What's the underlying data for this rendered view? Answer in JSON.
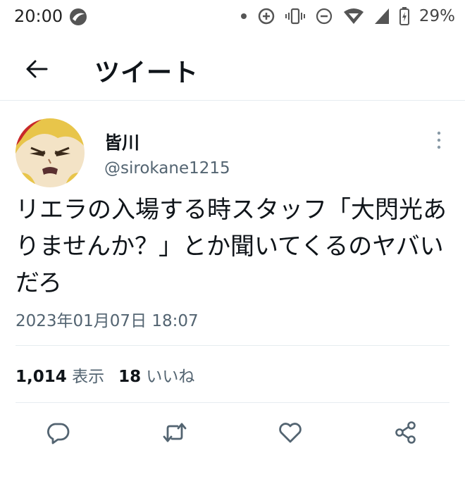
{
  "status_bar": {
    "time": "20:00",
    "battery": "29%",
    "icons": [
      "app-icon",
      "dot-icon",
      "data-saver-icon",
      "vibrate-icon",
      "do-not-disturb-icon",
      "wifi-icon",
      "signal-icon",
      "battery-icon"
    ]
  },
  "header": {
    "back_icon": "arrow-left-icon",
    "title": "ツイート"
  },
  "tweet": {
    "display_name": "皆川",
    "username": "@sirokane1215",
    "text": "リエラの入場する時スタッフ「大閃光ありませんか？」とか聞いてくるのヤバいだろ",
    "timestamp": "2023年01月07日 18:07",
    "views_count": "1,014",
    "views_label": "表示",
    "likes_count": "18",
    "likes_label": "いいね"
  },
  "actions": [
    "reply-icon",
    "retweet-icon",
    "like-icon",
    "share-icon"
  ],
  "colors": {
    "text_primary": "#0f1419",
    "text_secondary": "#536471",
    "divider": "#e6ecf0"
  }
}
